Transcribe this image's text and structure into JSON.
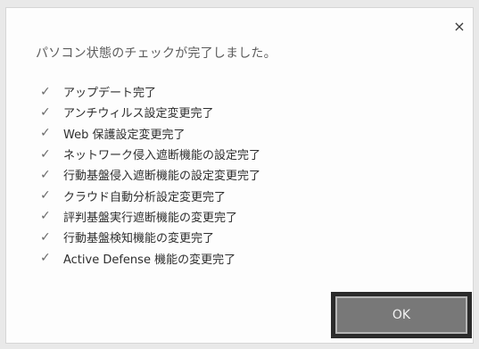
{
  "dialog": {
    "close_label": "×",
    "title": "パソコン状態のチェックが完了しました。",
    "items": [
      {
        "label": "アップデート完了"
      },
      {
        "label": "アンチウィルス設定変更完了"
      },
      {
        "label": "Web 保護設定変更完了"
      },
      {
        "label": "ネットワーク侵入遮断機能の設定完了"
      },
      {
        "label": "行動基盤侵入遮断機能の設定変更完了"
      },
      {
        "label": "クラウド自動分析設定変更完了"
      },
      {
        "label": "評判基盤実行遮断機能の変更完了"
      },
      {
        "label": "行動基盤検知機能の変更完了"
      },
      {
        "label": "Active Defense 機能の変更完了"
      }
    ],
    "check_icon": "check-icon",
    "ok_label": "OK"
  }
}
